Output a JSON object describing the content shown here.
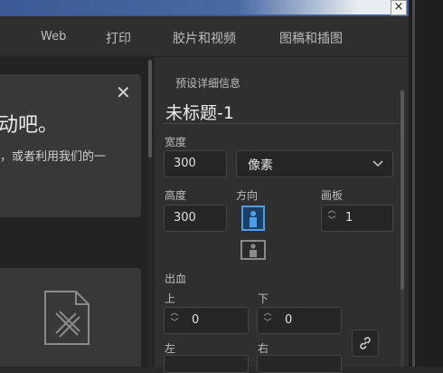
{
  "window": {
    "close_glyph": "×"
  },
  "tabs": [
    {
      "label": "Web"
    },
    {
      "label": "打印"
    },
    {
      "label": "胶片和视频"
    },
    {
      "label": "图稿和插图"
    }
  ],
  "welcome_card": {
    "heading": "动吧。",
    "body": "，或者利用我们的一"
  },
  "details": {
    "section_title": "预设详细信息",
    "doc_name": "未标题-1",
    "width_label": "宽度",
    "width_value": "300",
    "unit_value": "像素",
    "height_label": "高度",
    "height_value": "300",
    "orientation_label": "方向",
    "artboard_label": "画板",
    "artboard_value": "1",
    "bleed_label": "出血",
    "top_label": "上",
    "top_value": "0",
    "bottom_label": "下",
    "bottom_value": "0",
    "left_label": "左",
    "right_label": "右"
  },
  "colors": {
    "accent": "#4a9fe8",
    "panel": "#2f2f2f"
  }
}
